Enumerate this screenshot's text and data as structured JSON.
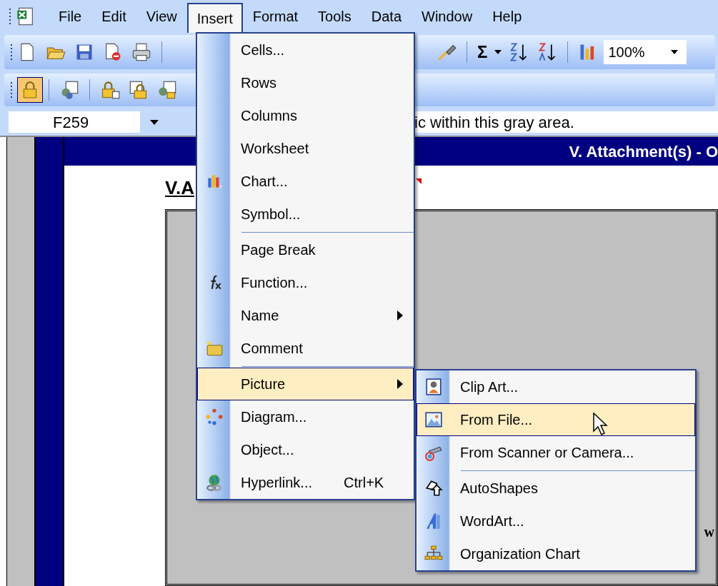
{
  "menubar": {
    "items": [
      {
        "label": "File",
        "selected": false
      },
      {
        "label": "Edit",
        "selected": false
      },
      {
        "label": "View",
        "selected": false
      },
      {
        "label": "Insert",
        "selected": true
      },
      {
        "label": "Format",
        "selected": false
      },
      {
        "label": "Tools",
        "selected": false
      },
      {
        "label": "Data",
        "selected": false
      },
      {
        "label": "Window",
        "selected": false
      },
      {
        "label": "Help",
        "selected": false
      }
    ]
  },
  "toolbar": {
    "zoom": "100%",
    "sum": "Σ"
  },
  "formula_bar": {
    "name_box": "F259",
    "text": "ic within this gray area."
  },
  "sheet": {
    "banner": "V. Attachment(s) - O",
    "heading": "V.A",
    "side_text": "w"
  },
  "insert_menu": {
    "items": [
      {
        "label": "Cells...",
        "submenu": false,
        "selected": false,
        "separator_before": false
      },
      {
        "label": "Rows",
        "submenu": false,
        "selected": false,
        "separator_before": false
      },
      {
        "label": "Columns",
        "submenu": false,
        "selected": false,
        "separator_before": false
      },
      {
        "label": "Worksheet",
        "submenu": false,
        "selected": false,
        "separator_before": false
      },
      {
        "label": "Chart...",
        "submenu": false,
        "selected": false,
        "separator_before": false
      },
      {
        "label": "Symbol...",
        "submenu": false,
        "selected": false,
        "separator_before": false
      },
      {
        "label": "Page Break",
        "submenu": false,
        "selected": false,
        "separator_before": true
      },
      {
        "label": "Function...",
        "submenu": false,
        "selected": false,
        "separator_before": false
      },
      {
        "label": "Name",
        "submenu": true,
        "selected": false,
        "separator_before": false
      },
      {
        "label": "Comment",
        "submenu": false,
        "selected": false,
        "separator_before": false
      },
      {
        "label": "Picture",
        "submenu": true,
        "selected": true,
        "separator_before": true
      },
      {
        "label": "Diagram...",
        "submenu": false,
        "selected": false,
        "separator_before": false
      },
      {
        "label": "Object...",
        "submenu": false,
        "selected": false,
        "separator_before": false
      },
      {
        "label": "Hyperlink...",
        "shortcut": "Ctrl+K",
        "submenu": false,
        "selected": false,
        "separator_before": false
      }
    ]
  },
  "picture_menu": {
    "items": [
      {
        "label": "Clip Art...",
        "selected": false,
        "separator_before": false
      },
      {
        "label": "From File...",
        "selected": true,
        "separator_before": false
      },
      {
        "label": "From Scanner or Camera...",
        "selected": false,
        "separator_before": false
      },
      {
        "label": "AutoShapes",
        "selected": false,
        "separator_before": true
      },
      {
        "label": "WordArt...",
        "selected": false,
        "separator_before": false
      },
      {
        "label": "Organization Chart",
        "selected": false,
        "separator_before": false
      }
    ]
  }
}
